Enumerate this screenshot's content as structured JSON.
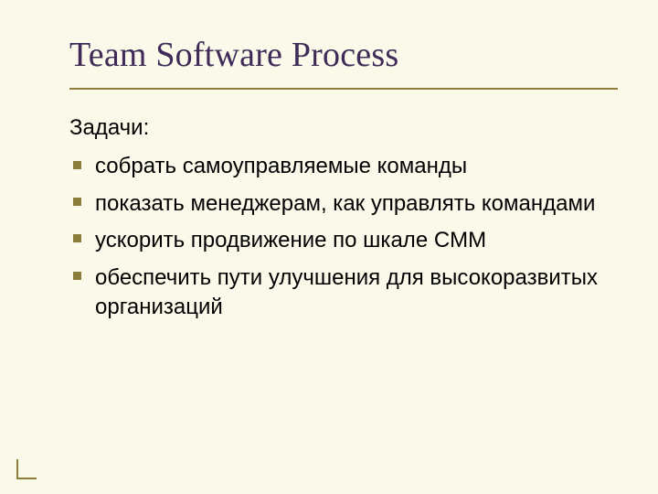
{
  "title": "Team Software Process",
  "lead": "Задачи:",
  "bullets": [
    "собрать самоуправляемые команды",
    "показать менеджерам, как управлять командами",
    "ускорить продвижение по шкале CMM",
    "обеспечить пути улучшения для высокоразвитых организаций"
  ]
}
